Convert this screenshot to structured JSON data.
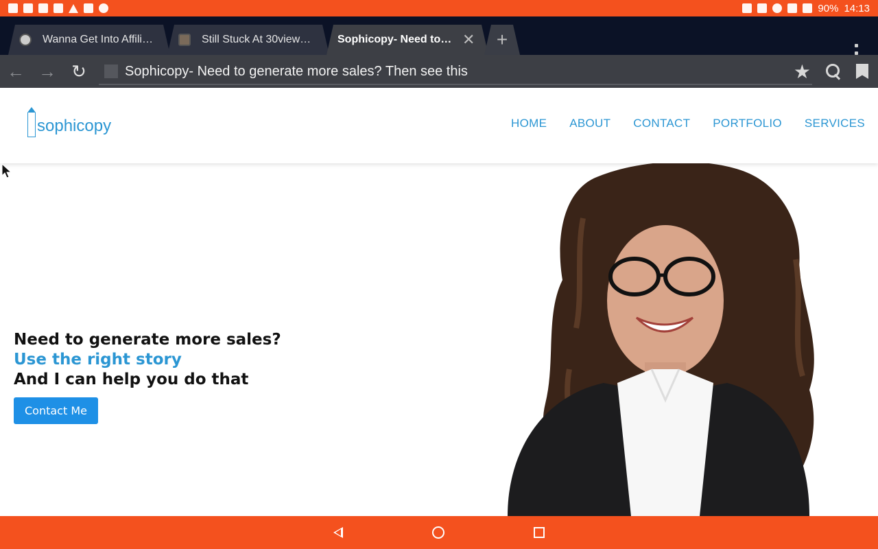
{
  "status_bar": {
    "battery": "90%",
    "time": "14:13"
  },
  "tabs": [
    {
      "title": "Wanna Get Into Affili…"
    },
    {
      "title": "Still Stuck At 30view…"
    },
    {
      "title": "Sophicopy- Need to…"
    }
  ],
  "address_bar": {
    "url_text": "Sophicopy- Need to generate more sales? Then see this"
  },
  "site": {
    "logo_text": "sophicopy",
    "nav": [
      "HOME",
      "ABOUT",
      "CONTACT",
      "PORTFOLIO",
      "SERVICES"
    ],
    "hero": {
      "line1": "Need to generate more sales?",
      "line2": "Use the right story",
      "line3": "And I can help you do that",
      "cta": "Contact Me"
    }
  },
  "colors": {
    "system_bar": "#f4511e",
    "brand_blue": "#2b96d3",
    "button_blue": "#1e90e6",
    "tab_strip": "#0b1226",
    "toolbar": "#3d3f45"
  }
}
